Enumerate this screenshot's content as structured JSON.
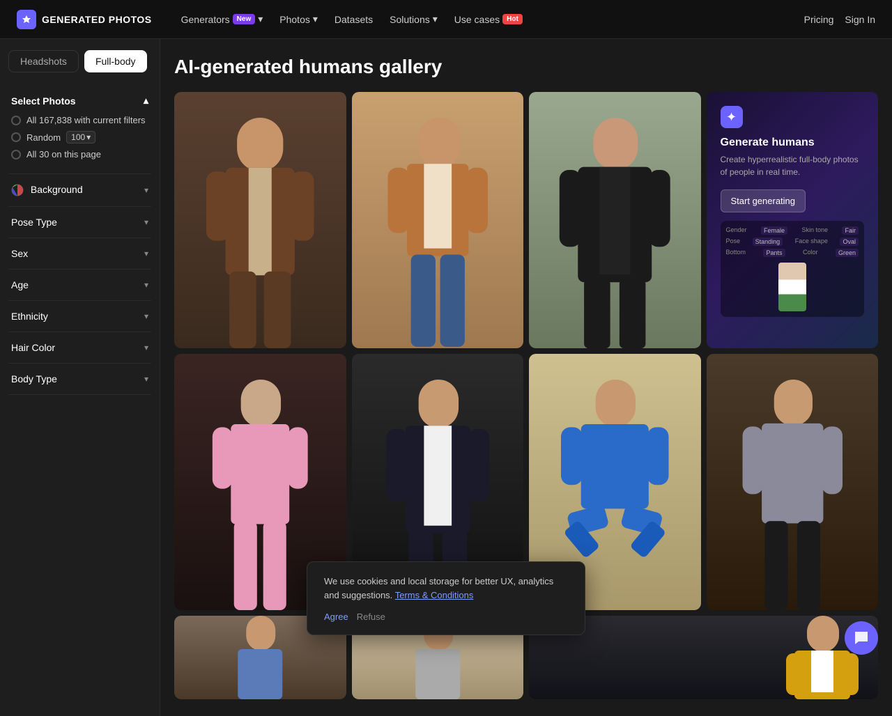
{
  "brand": {
    "logo_text": "GENERATED PHOTOS",
    "logo_icon": "✦"
  },
  "navbar": {
    "items": [
      {
        "id": "generators",
        "label": "Generators",
        "badge": "New",
        "badge_type": "new",
        "has_dropdown": true
      },
      {
        "id": "photos",
        "label": "Photos",
        "badge": null,
        "has_dropdown": true
      },
      {
        "id": "datasets",
        "label": "Datasets",
        "badge": null,
        "has_dropdown": false
      },
      {
        "id": "solutions",
        "label": "Solutions",
        "badge": null,
        "has_dropdown": true
      },
      {
        "id": "use-cases",
        "label": "Use cases",
        "badge": "Hot",
        "badge_type": "hot",
        "has_dropdown": false
      }
    ],
    "right": {
      "pricing": "Pricing",
      "sign_in": "Sign In"
    }
  },
  "tabs": {
    "headshots": "Headshots",
    "fullbody": "Full-body"
  },
  "page_title": "AI-generated humans gallery",
  "sidebar": {
    "select_photos": {
      "title": "Select Photos",
      "options": [
        {
          "id": "all",
          "label": "All 167,838 with current filters"
        },
        {
          "id": "random",
          "label": "Random",
          "value": "100"
        },
        {
          "id": "page",
          "label": "All 30 on this page"
        }
      ]
    },
    "filters": [
      {
        "id": "background",
        "label": "Background",
        "has_icon": true
      },
      {
        "id": "pose-type",
        "label": "Pose Type"
      },
      {
        "id": "sex",
        "label": "Sex"
      },
      {
        "id": "age",
        "label": "Age"
      },
      {
        "id": "ethnicity",
        "label": "Ethnicity"
      },
      {
        "id": "hair-color",
        "label": "Hair Color"
      },
      {
        "id": "body-type",
        "label": "Body Type"
      }
    ]
  },
  "generate_card": {
    "icon": "✦",
    "title": "Generate humans",
    "description": "Create hyperrealistic full-body photos of people in real time.",
    "button_label": "Start generating",
    "preview": {
      "rows": [
        {
          "label": "Gender",
          "value": "Female"
        },
        {
          "label": "Skin tone",
          "value": "Fair"
        },
        {
          "label": "Pose",
          "value": "Standing"
        },
        {
          "label": "Face shape",
          "value": "Oval"
        },
        {
          "label": "Bottom",
          "value": "Pants"
        },
        {
          "label": "Color",
          "value": "Green"
        }
      ]
    }
  },
  "photos": [
    {
      "id": 1,
      "bg": "#3a2a1a",
      "person": "man-suit-brown",
      "description": "Man in brown suit"
    },
    {
      "id": 2,
      "bg": "#c8a070",
      "person": "man-cardigan",
      "description": "Young man in cardigan"
    },
    {
      "id": 3,
      "bg": "#b0b8a0",
      "person": "man-black-coat",
      "description": "Man in black coat"
    },
    {
      "id": 4,
      "bg": "#1a1535",
      "person": "generate-card",
      "description": "Generate card"
    },
    {
      "id": 5,
      "bg": "#2a1a1a",
      "person": "old-woman-pink",
      "description": "Old woman in pink pajamas"
    },
    {
      "id": 6,
      "bg": "#2a2a2a",
      "person": "young-man-suit",
      "description": "Young man in black suit"
    },
    {
      "id": 7,
      "bg": "#c8b890",
      "person": "man-scrubs-blue",
      "description": "Man in blue scrubs"
    },
    {
      "id": 8,
      "bg": "#4a3a2a",
      "person": "man-hallway",
      "description": "Man in hallway"
    },
    {
      "id": 9,
      "bg": "#8a7060",
      "person": "man-denim",
      "description": "Man in denim jacket"
    },
    {
      "id": 10,
      "bg": "#c8b890",
      "person": "man-glasses",
      "description": "Man with glasses"
    },
    {
      "id": 11,
      "bg": "#2a2030",
      "person": "woman-yellow",
      "description": "Woman in yellow jacket"
    }
  ],
  "cookie_banner": {
    "text": "We use cookies and local storage for better UX, analytics and suggestions.",
    "link_text": "Terms & Conditions",
    "agree_label": "Agree",
    "refuse_label": "Refuse"
  },
  "chat_icon": "💬"
}
